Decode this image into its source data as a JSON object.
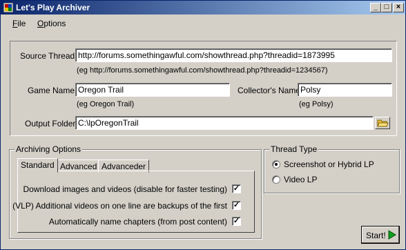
{
  "window": {
    "title": "Let's Play Archiver"
  },
  "titlebar": {
    "minimize": "_",
    "maximize": "□",
    "close": "×"
  },
  "menu": {
    "file": {
      "mnemonic": "F",
      "rest": "ile"
    },
    "options": {
      "mnemonic": "O",
      "rest": "ptions"
    }
  },
  "source": {
    "label": "Source Thread",
    "value": "http://forums.somethingawful.com/showthread.php?threadid=1873995",
    "hint": "(eg http://forums.somethingawful.com/showthread.php?threadid=1234567)"
  },
  "game": {
    "label": "Game Name",
    "value": "Oregon Trail",
    "hint": "(eg Oregon Trail)"
  },
  "collector": {
    "label": "Collector's Name",
    "value": "Polsy",
    "hint": "(eg Polsy)"
  },
  "output": {
    "label": "Output Folder",
    "value": "C:\\lpOregonTrail"
  },
  "archiving": {
    "title": "Archiving Options",
    "tabs": [
      "Standard",
      "Advanced",
      "Advanceder"
    ],
    "options": [
      {
        "label": "Download images and videos (disable for faster testing)",
        "checked": "✓"
      },
      {
        "label": "(VLP) Additional videos on one line are backups of the first",
        "checked": "✓"
      },
      {
        "label": "Automatically name chapters (from post content)",
        "checked": "✓"
      }
    ]
  },
  "thread_type": {
    "title": "Thread Type",
    "options": [
      "Screenshot or Hybrid LP",
      "Video LP"
    ],
    "selected": "Screenshot or Hybrid LP"
  },
  "start_button": {
    "label": "Start!"
  }
}
